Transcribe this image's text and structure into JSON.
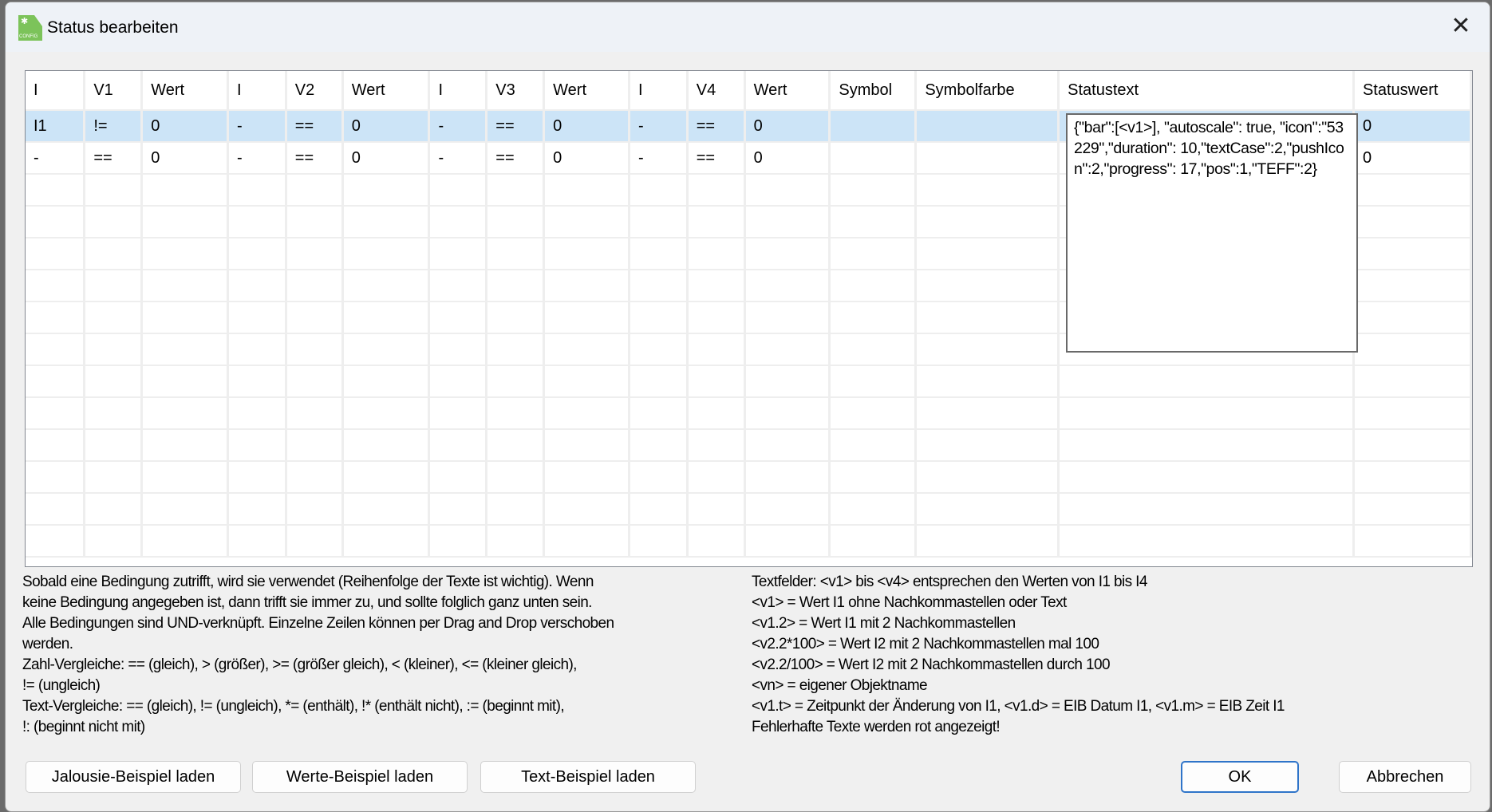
{
  "window": {
    "title": "Status bearbeiten",
    "icon": "config-icon",
    "icon_label": "CONFIG",
    "close_icon": "close-icon"
  },
  "table": {
    "columns": [
      "I",
      "V1",
      "Wert",
      "I",
      "V2",
      "Wert",
      "I",
      "V3",
      "Wert",
      "I",
      "V4",
      "Wert",
      "Symbol",
      "Symbolfarbe",
      "Statustext",
      "Statuswert"
    ],
    "rows": [
      [
        "I1",
        "!=",
        "0",
        "-",
        "==",
        "0",
        "-",
        "==",
        "0",
        "-",
        "==",
        "0",
        "",
        "",
        "",
        "0"
      ],
      [
        "-",
        "==",
        "0",
        "-",
        "==",
        "0",
        "-",
        "==",
        "0",
        "-",
        "==",
        "0",
        "",
        "",
        "",
        "0"
      ]
    ],
    "selected_row": 0,
    "empty_rows": 12,
    "selection_color": "#cce4f7"
  },
  "editor": {
    "value": "{\"bar\":[<v1>], \"autoscale\": true, \"icon\":\"53229\",\"duration\": 10,\"textCase\":2,\"pushIcon\":2,\"progress\": 17,\"pos\":1,\"TEFF\":2}"
  },
  "help_left": [
    "Sobald eine Bedingung zutrifft, wird sie verwendet (Reihenfolge der Texte ist wichtig). Wenn",
    "keine Bedingung angegeben ist, dann trifft sie immer zu, und sollte folglich ganz unten sein.",
    "Alle Bedingungen sind UND-verknüpft. Einzelne Zeilen können per Drag and Drop verschoben",
    "werden.",
    "Zahl-Vergleiche: == (gleich), > (größer), >= (größer gleich), < (kleiner), <= (kleiner gleich),",
    "!= (ungleich)",
    "Text-Vergleiche: == (gleich), != (ungleich), *= (enthält), !* (enthält nicht), := (beginnt mit),",
    "!: (beginnt nicht mit)"
  ],
  "help_right": [
    "Textfelder: <v1> bis <v4> entsprechen den Werten von I1 bis I4",
    "<v1> = Wert I1 ohne Nachkommastellen oder Text",
    "<v1.2> = Wert I1 mit 2 Nachkommastellen",
    "<v2.2*100> = Wert I2 mit 2 Nachkommastellen mal 100",
    "<v2.2/100> = Wert I2 mit 2 Nachkommastellen durch 100",
    "<vn> = eigener Objektname",
    "<v1.t> = Zeitpunkt der Änderung von I1, <v1.d> = EIB Datum I1, <v1.m> = EIB Zeit I1",
    "Fehlerhafte Texte werden rot angezeigt!"
  ],
  "buttons": {
    "jalousie": "Jalousie-Beispiel laden",
    "werte": "Werte-Beispiel laden",
    "text": "Text-Beispiel laden",
    "ok": "OK",
    "cancel": "Abbrechen"
  }
}
